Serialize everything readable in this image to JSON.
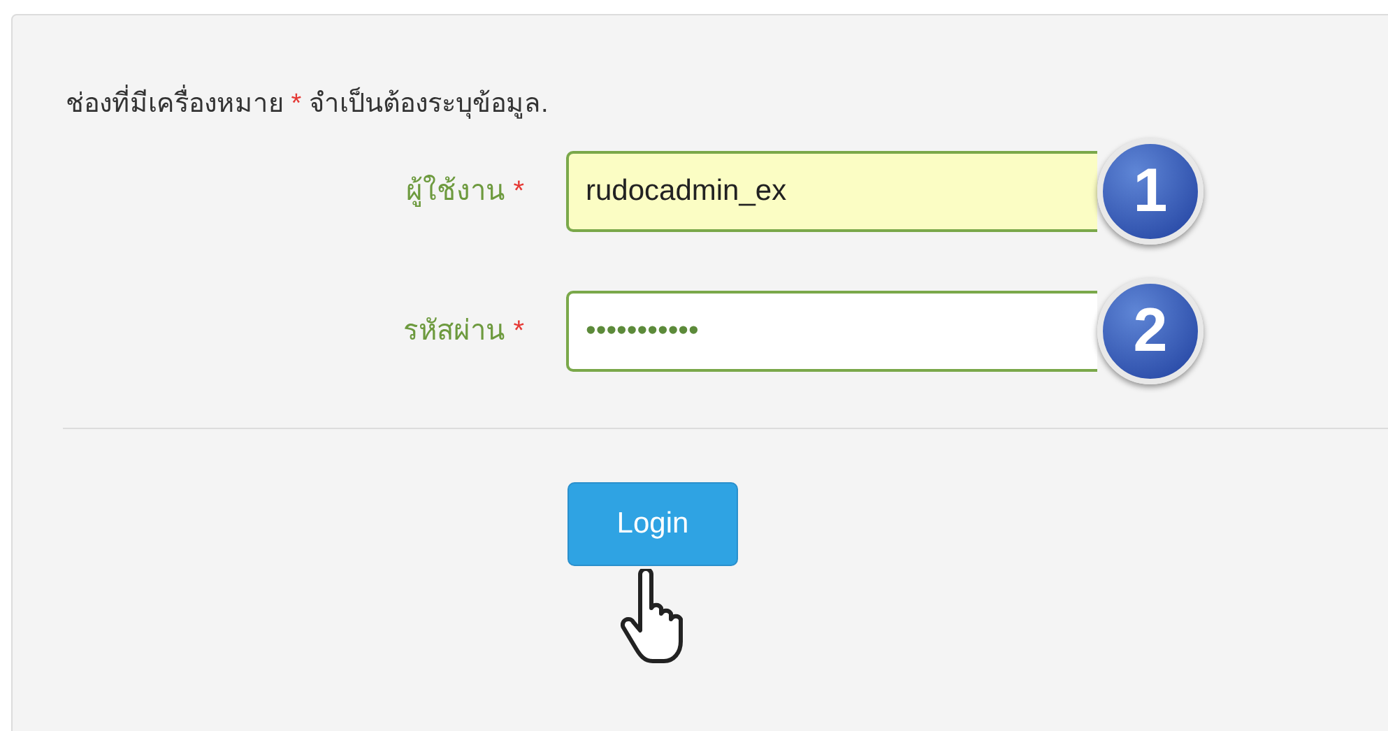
{
  "note": {
    "text_before": "ช่องที่มีเครื่องหมาย",
    "mark": "*",
    "text_after": "จำเป็นต้องระบุข้อมูล."
  },
  "fields": [
    {
      "label": "ผู้ใช้งาน",
      "mark": "*",
      "value": "rudocadmin_ex",
      "autofilled": true,
      "badge": "1"
    },
    {
      "label": "รหัสผ่าน",
      "mark": "*",
      "value": "•••••••••••",
      "autofilled": false,
      "badge": "2"
    }
  ],
  "button": {
    "label": "Login"
  }
}
